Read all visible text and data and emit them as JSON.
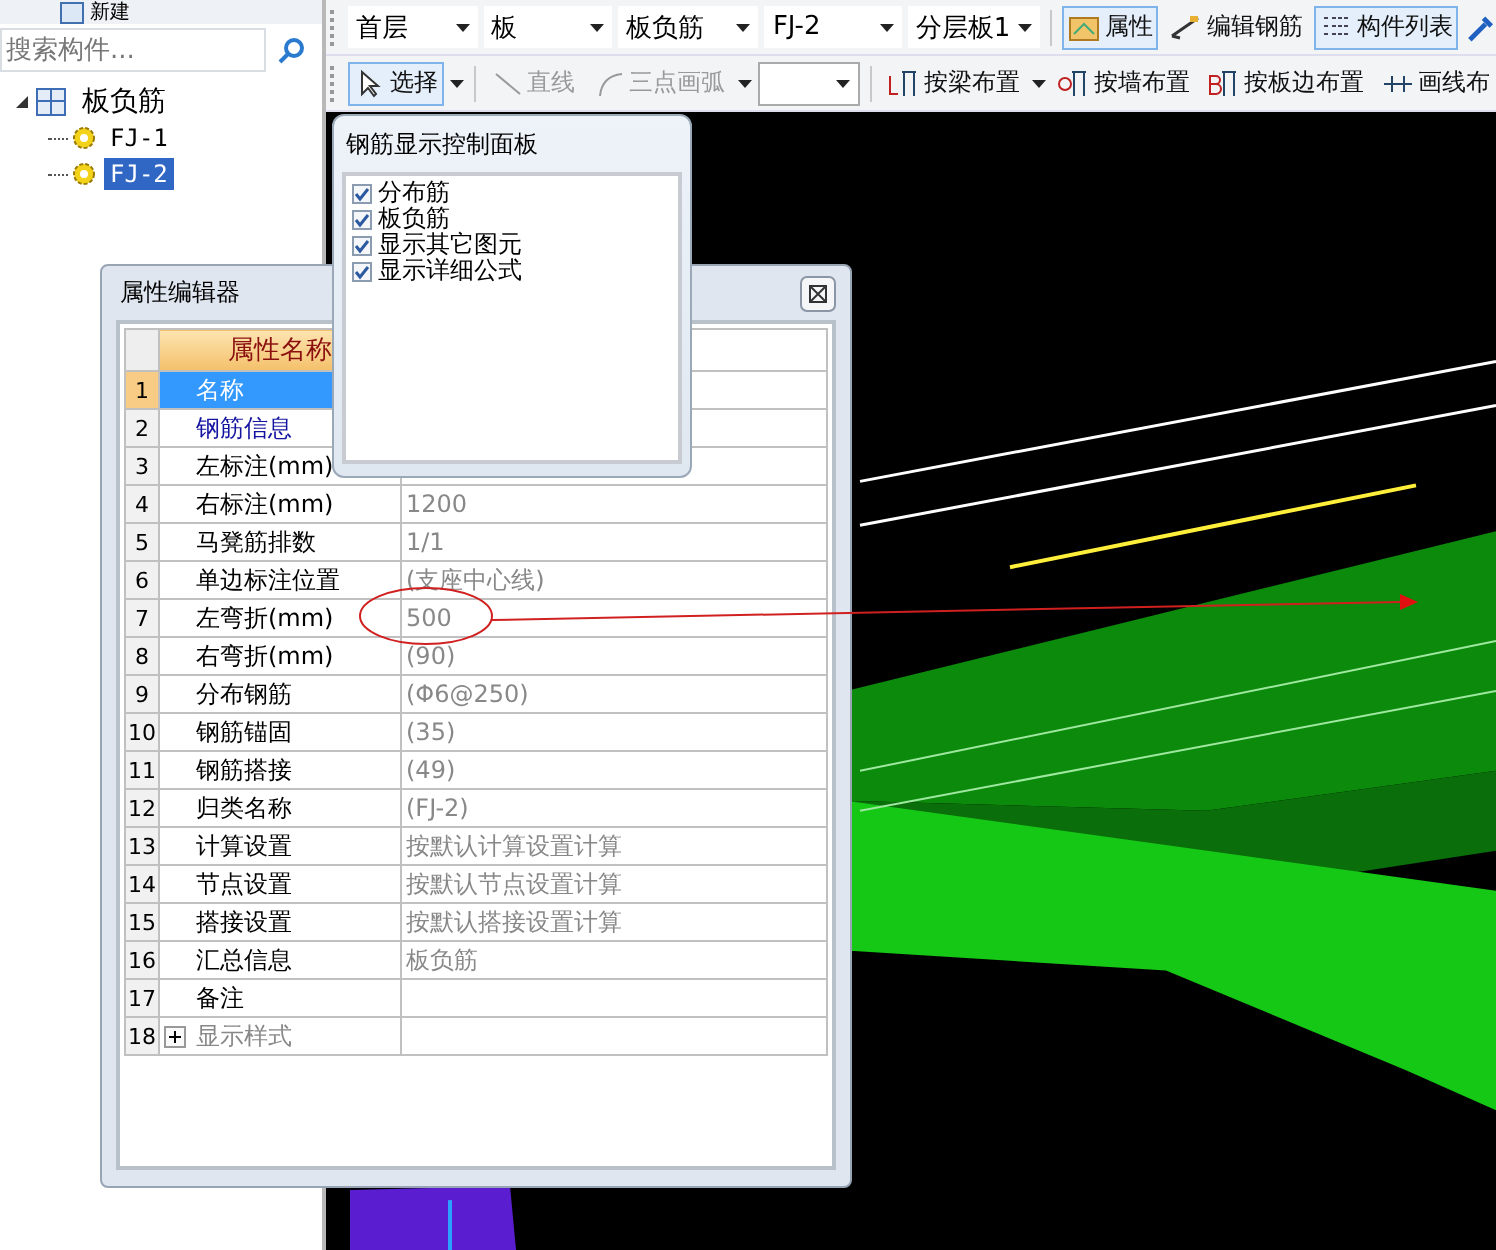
{
  "left_panel": {
    "toolbar": {
      "new_label": "新建"
    },
    "search": {
      "placeholder": "搜索构件..."
    },
    "tree": [
      {
        "label": "板负筋",
        "expanded": true,
        "selected": false,
        "children": [
          {
            "label": "FJ-1",
            "selected": false
          },
          {
            "label": "FJ-2",
            "selected": true
          }
        ]
      }
    ]
  },
  "toolbar_1": {
    "dropdowns": [
      {
        "value": "首层"
      },
      {
        "value": "板"
      },
      {
        "value": "板负筋"
      },
      {
        "value": "FJ-2"
      },
      {
        "value": "分层板1"
      }
    ],
    "buttons": [
      {
        "label": "属性",
        "selected": true
      },
      {
        "label": "编辑钢筋",
        "selected": false
      },
      {
        "label": "构件列表",
        "selected": true
      }
    ]
  },
  "toolbar_2": {
    "items": [
      {
        "kind": "button",
        "label": "选择",
        "selected": true,
        "disabled": false,
        "caret": true
      },
      {
        "kind": "button",
        "label": "直线",
        "selected": false,
        "disabled": true,
        "caret": false
      },
      {
        "kind": "button",
        "label": "三点画弧",
        "selected": false,
        "disabled": true,
        "caret": true
      },
      {
        "kind": "combo"
      },
      {
        "kind": "button",
        "label": "按梁布置",
        "selected": false,
        "disabled": false,
        "caret": true
      },
      {
        "kind": "button",
        "label": "按墙布置",
        "selected": false,
        "disabled": false,
        "caret": false
      },
      {
        "kind": "button",
        "label": "按板边布置",
        "selected": false,
        "disabled": false,
        "caret": false
      },
      {
        "kind": "button",
        "label": "画线布",
        "selected": false,
        "disabled": false,
        "caret": false
      }
    ]
  },
  "control_panel": {
    "title": "钢筋显示控制面板",
    "options": [
      {
        "label": "分布筋",
        "checked": true
      },
      {
        "label": "板负筋",
        "checked": true
      },
      {
        "label": "显示其它图元",
        "checked": true
      },
      {
        "label": "显示详细公式",
        "checked": true
      }
    ]
  },
  "property_editor": {
    "title": "属性编辑器",
    "columns": [
      "属性名称"
    ],
    "rows": [
      {
        "number": "1",
        "name": "名称",
        "kind": "normal",
        "selected": true
      },
      {
        "number": "2",
        "name": "钢筋信息",
        "kind": "link",
        "selected": false
      },
      {
        "number": "3",
        "name": "左标注(mm)",
        "kind": "normal",
        "selected": false
      },
      {
        "number": "4",
        "name": "右标注(mm)",
        "value": "1200",
        "kind": "normal",
        "selected": false
      },
      {
        "number": "5",
        "name": "马凳筋排数",
        "value": "1/1",
        "kind": "normal",
        "selected": false
      },
      {
        "number": "6",
        "name": "单边标注位置",
        "value": "(支座中心线)",
        "kind": "normal",
        "selected": false
      },
      {
        "number": "7",
        "name": "左弯折(mm)",
        "value": "500",
        "kind": "normal",
        "selected": false
      },
      {
        "number": "8",
        "name": "右弯折(mm)",
        "value": "(90)",
        "kind": "normal",
        "selected": false
      },
      {
        "number": "9",
        "name": "分布钢筋",
        "value": "(Φ6@250)",
        "kind": "normal",
        "selected": false
      },
      {
        "number": "10",
        "name": "钢筋锚固",
        "value": "(35)",
        "kind": "normal",
        "selected": false
      },
      {
        "number": "11",
        "name": "钢筋搭接",
        "value": "(49)",
        "kind": "normal",
        "selected": false
      },
      {
        "number": "12",
        "name": "归类名称",
        "value": "(FJ-2)",
        "kind": "normal",
        "selected": false
      },
      {
        "number": "13",
        "name": "计算设置",
        "value": "按默认计算设置计算",
        "kind": "normal",
        "selected": false
      },
      {
        "number": "14",
        "name": "节点设置",
        "value": "按默认节点设置计算",
        "kind": "normal",
        "selected": false
      },
      {
        "number": "15",
        "name": "搭接设置",
        "value": "按默认搭接设置计算",
        "kind": "normal",
        "selected": false
      },
      {
        "number": "16",
        "name": "汇总信息",
        "value": "板负筋",
        "kind": "normal",
        "selected": false
      },
      {
        "number": "17",
        "name": "备注",
        "kind": "normal",
        "selected": false
      },
      {
        "number": "18",
        "name": "显示样式",
        "kind": "group",
        "selected": false,
        "expanded": false
      }
    ]
  }
}
